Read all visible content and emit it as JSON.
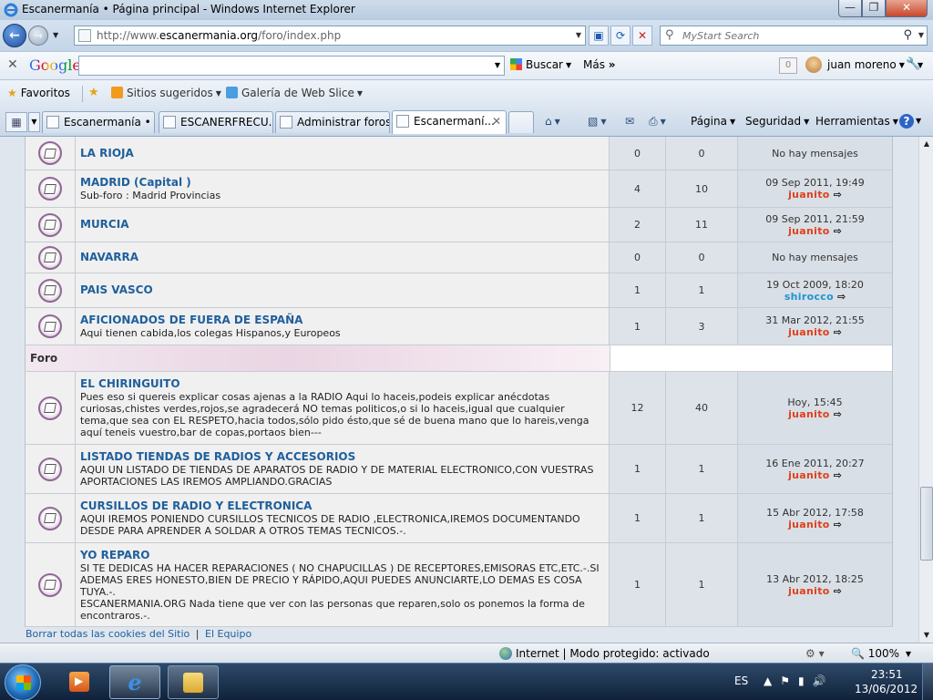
{
  "window": {
    "title": "Escanermanía • Página principal - Windows Internet Explorer",
    "min_glyph": "—",
    "max_glyph": "❐",
    "close_glyph": "✕"
  },
  "address": {
    "url_prefix": "http://www.",
    "url_domain": "escanermania.org",
    "url_path": "/foro/index.php",
    "search_placeholder": "MyStart Search"
  },
  "google_bar": {
    "logo": "Google",
    "search_label": "Buscar",
    "more_label": "Más",
    "counter": "0",
    "user": "juan moreno"
  },
  "favorites_bar": {
    "favorites": "Favoritos",
    "suggested": "Sitios sugeridos",
    "slice_gallery": "Galería de Web Slice"
  },
  "tabs": [
    {
      "label": "Escanermanía • ..."
    },
    {
      "label": "ESCANERFRECU..."
    },
    {
      "label": "Administrar foros"
    },
    {
      "label": "Escanermaní..."
    }
  ],
  "command_bar": {
    "page": "Página",
    "security": "Seguridad",
    "tools": "Herramientas"
  },
  "forum": {
    "rows_top": [
      {
        "name": "LA RIOJA",
        "desc": "",
        "topics": "0",
        "posts": "0",
        "last_date": "No hay mensajes",
        "last_user": ""
      },
      {
        "name": "MADRID (Capital )",
        "desc": "Sub-foro : Madrid Provincias",
        "topics": "4",
        "posts": "10",
        "last_date": "09 Sep 2011, 19:49",
        "last_user": "juanito"
      },
      {
        "name": "MURCIA",
        "desc": "",
        "topics": "2",
        "posts": "11",
        "last_date": "09 Sep 2011, 21:59",
        "last_user": "juanito"
      },
      {
        "name": "NAVARRA",
        "desc": "",
        "topics": "0",
        "posts": "0",
        "last_date": "No hay mensajes",
        "last_user": ""
      },
      {
        "name": "PAIS VASCO",
        "desc": "",
        "topics": "1",
        "posts": "1",
        "last_date": "19 Oct 2009, 18:20",
        "last_user": "shirocco"
      },
      {
        "name": "AFICIONADOS DE FUERA DE ESPAÑA",
        "desc": "Aqui tienen cabida,los colegas Hispanos,y Europeos",
        "topics": "1",
        "posts": "3",
        "last_date": "31 Mar 2012, 21:55",
        "last_user": "juanito"
      }
    ],
    "category": "Foro",
    "rows_bottom": [
      {
        "name": "EL CHIRINGUITO",
        "desc": "Pues eso si quereis explicar cosas ajenas a la RADIO Aqui lo haceis,podeis explicar anécdotas curiosas,chistes verdes,rojos,se agradecerá NO temas politicos,o si lo haceis,igual que cualquier tema,que sea con EL RESPETO,hacia todos,sólo pido ésto,que sé de buena mano que lo hareis,venga aquí teneis vuestro,bar de copas,portaos bien---",
        "topics": "12",
        "posts": "40",
        "last_date": "Hoy, 15:45",
        "last_user": "juanito"
      },
      {
        "name": "LISTADO TIENDAS DE RADIOS Y ACCESORIOS",
        "desc": "AQUI UN LISTADO DE TIENDAS DE APARATOS DE RADIO Y DE MATERIAL ELECTRONICO,CON VUESTRAS APORTACIONES LAS IREMOS AMPLIANDO.GRACIAS",
        "topics": "1",
        "posts": "1",
        "last_date": "16 Ene 2011, 20:27",
        "last_user": "juanito"
      },
      {
        "name": "CURSILLOS DE RADIO Y ELECTRONICA",
        "desc": "AQUI IREMOS PONIENDO CURSILLOS TECNICOS DE RADIO ,ELECTRONICA,IREMOS DOCUMENTANDO DESDE PARA APRENDER A SOLDAR A OTROS TEMAS TECNICOS.-.",
        "topics": "1",
        "posts": "1",
        "last_date": "15 Abr 2012, 17:58",
        "last_user": "juanito"
      },
      {
        "name": "YO REPARO",
        "desc": "SI TE DEDICAS HA HACER REPARACIONES ( NO CHAPUCILLAS ) DE RECEPTORES,EMISORAS ETC,ETC.-.SI ADEMAS ERES HONESTO,BIEN DE PRECIO Y RÁPIDO,AQUI PUEDES ANUNCIARTE,LO DEMAS ES COSA TUYA.-.",
        "desc2": "ESCANERMANIA.ORG Nada tiene que ver con las personas que reparen,solo os ponemos la forma de encontraros.-.",
        "topics": "1",
        "posts": "1",
        "last_date": "13 Abr 2012, 18:25",
        "last_user": "juanito"
      }
    ],
    "footer_link_1": "Borrar todas las cookies del Sitio",
    "footer_sep": "|",
    "footer_link_2": "El Equipo"
  },
  "status": {
    "zone": "Internet | Modo protegido: activado",
    "zoom": "100%"
  },
  "taskbar": {
    "lang": "ES",
    "time": "23:51",
    "date": "13/06/2012"
  },
  "colors": {
    "forum_link": "#1f5f9c",
    "user_red": "#e0401b",
    "user_blue": "#1f93d1"
  }
}
